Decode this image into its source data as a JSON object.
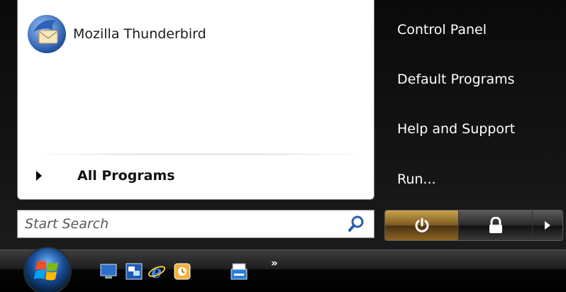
{
  "left_pane": {
    "pinned": [
      {
        "label": "Mozilla Thunderbird",
        "icon": "thunderbird-icon"
      }
    ],
    "all_programs_label": "All Programs"
  },
  "right_pane": {
    "items": [
      {
        "label": "Control Panel"
      },
      {
        "label": "Default Programs"
      },
      {
        "label": "Help and Support"
      },
      {
        "label": "Run..."
      }
    ]
  },
  "search": {
    "placeholder": "Start Search",
    "value": ""
  },
  "buttons": {
    "power": "power-icon",
    "lock": "lock-icon",
    "more": "arrow-right-icon"
  },
  "taskbar": {
    "quick_launch": [
      "show-desktop-icon",
      "switch-windows-icon",
      "internet-explorer-icon",
      "outlook-icon",
      "fax-icon"
    ],
    "overflow_label": "»"
  },
  "colors": {
    "menu_dark": "#0b0b0b",
    "power_accent": "#c9a24a",
    "text_white": "#ffffff"
  }
}
